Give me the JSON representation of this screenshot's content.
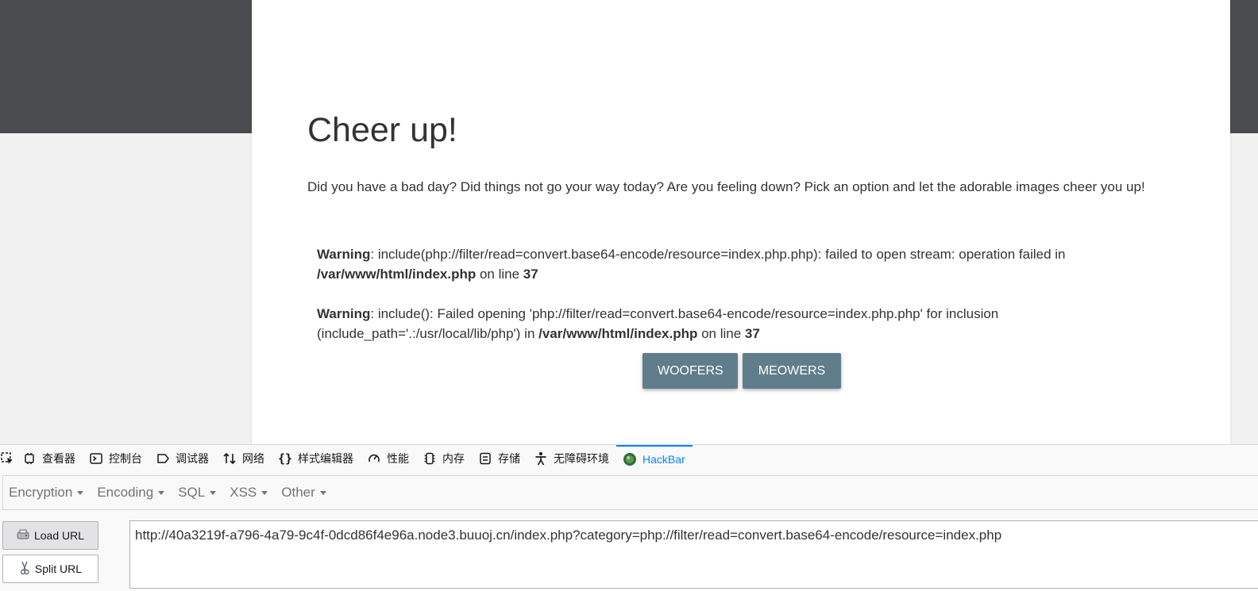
{
  "page": {
    "title": "Cheer up!",
    "lead": "Did you have a bad day? Did things not go your way today? Are you feeling down? Pick an option and let the adorable images cheer you up!",
    "warnings": [
      {
        "label": "Warning",
        "msg": ": include(php://filter/read=convert.base64-encode/resource=index.php.php): failed to open stream: operation failed in ",
        "path": "/var/www/html/index.php",
        "on_line": " on line ",
        "line": "37"
      },
      {
        "label": "Warning",
        "msg": ": include(): Failed opening 'php://filter/read=convert.base64-encode/resource=index.php.php' for inclusion (include_path='.:/usr/local/lib/php') in ",
        "path": "/var/www/html/index.php",
        "on_line": " on line ",
        "line": "37"
      }
    ],
    "buttons": {
      "woofers": "WOOFERS",
      "meowers": "MEOWERS"
    }
  },
  "devtools": {
    "tabs": [
      {
        "label": "查看器",
        "icon": "inspector-icon"
      },
      {
        "label": "控制台",
        "icon": "console-icon"
      },
      {
        "label": "调试器",
        "icon": "debugger-icon"
      },
      {
        "label": "网络",
        "icon": "network-icon"
      },
      {
        "label": "样式编辑器",
        "icon": "style-editor-icon"
      },
      {
        "label": "性能",
        "icon": "performance-icon"
      },
      {
        "label": "内存",
        "icon": "memory-icon"
      },
      {
        "label": "存储",
        "icon": "storage-icon"
      },
      {
        "label": "无障碍环境",
        "icon": "accessibility-icon"
      },
      {
        "label": "HackBar",
        "icon": "hackbar-icon",
        "active": true
      }
    ]
  },
  "hackbar": {
    "menus": [
      "Encryption",
      "Encoding",
      "SQL",
      "XSS",
      "Other"
    ],
    "load_url": "Load URL",
    "split_url": "Split URL",
    "url": "http://40a3219f-a796-4a79-9c4f-0dcd86f4e96a.node3.buuoj.cn/index.php?category=php://filter/read=convert.base64-encode/resource=index.php"
  },
  "colors": {
    "header_band": "#4a4b4f",
    "button": "#607d8b",
    "active_tab": "#0a84ff"
  }
}
